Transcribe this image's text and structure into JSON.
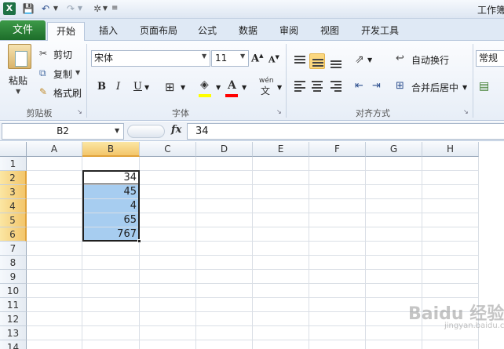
{
  "titlebar": {
    "window_title": "工作簿",
    "icons": [
      "excel-icon",
      "save-icon",
      "undo-icon",
      "redo-icon",
      "tools-icon",
      "customize-icon"
    ]
  },
  "tabs": {
    "file": "文件",
    "home": "开始",
    "insert": "插入",
    "page_layout": "页面布局",
    "formulas": "公式",
    "data": "数据",
    "review": "审阅",
    "view": "视图",
    "developer": "开发工具",
    "active": "开始"
  },
  "ribbon": {
    "clipboard": {
      "paste": "粘贴",
      "cut": "剪切",
      "copy": "复制",
      "format_painter": "格式刷",
      "group_label": "剪贴板"
    },
    "font": {
      "font_name": "宋体",
      "font_size": "11",
      "grow": "A",
      "shrink": "A",
      "bold": "B",
      "italic": "I",
      "underline": "U",
      "font_color_glyph": "A",
      "phonetic_top": "wén",
      "phonetic_main": "文",
      "group_label": "字体",
      "fill_color": "#ffff00",
      "font_color": "#ff0000"
    },
    "alignment": {
      "wrap_text": "自动换行",
      "merge_center": "合并后居中",
      "group_label": "对齐方式"
    },
    "number": {
      "format": "常规"
    }
  },
  "formula_bar": {
    "name_box": "B2",
    "fx": "fx",
    "content": "34"
  },
  "sheet": {
    "columns": [
      "A",
      "B",
      "C",
      "D",
      "E",
      "F",
      "G",
      "H"
    ],
    "rows": [
      "1",
      "2",
      "3",
      "4",
      "5",
      "6",
      "7",
      "8",
      "9",
      "10",
      "11",
      "12",
      "13",
      "14"
    ],
    "selected_column": "B",
    "selected_rows": [
      "2",
      "3",
      "4",
      "5",
      "6"
    ],
    "active_cell": "B2",
    "selection_range": "B2:B6",
    "cells": {
      "B2": "34",
      "B3": "45",
      "B4": "4",
      "B5": "65",
      "B6": "767"
    },
    "selection_color": "#a7cdf0"
  },
  "watermark": {
    "text": "Baidu 经验",
    "sub": "jingyan.baidu.com"
  }
}
